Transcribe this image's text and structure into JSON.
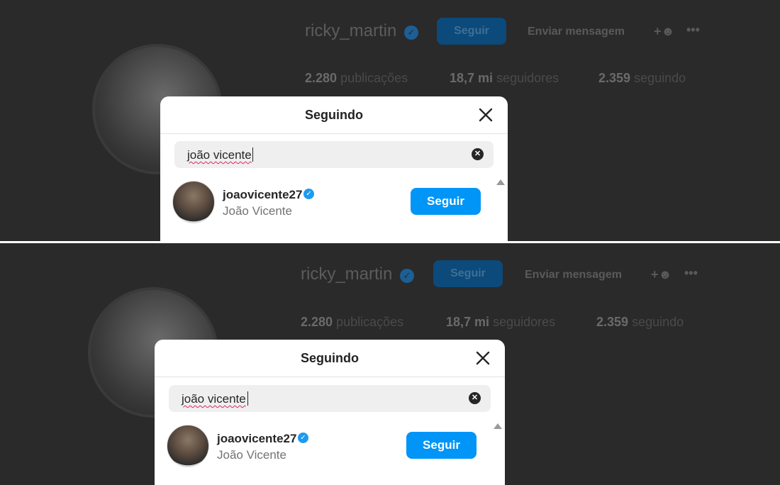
{
  "profile": {
    "username": "ricky_martin",
    "follow_label": "Seguir",
    "message_label": "Enviar mensagem",
    "add_person_icon": "add-person-icon",
    "more_icon": "•••",
    "stats": [
      {
        "value": "2.280",
        "label": "publicações"
      },
      {
        "value": "18,7 mi",
        "label": "seguidores"
      },
      {
        "value": "2.359",
        "label": "seguindo"
      }
    ]
  },
  "modal": {
    "title": "Seguindo",
    "search_value": "joão vicente",
    "result": {
      "username": "joaovicente27",
      "full_name": "João Vicente",
      "follow_label": "Seguir"
    }
  },
  "colors": {
    "accent": "#0095f6",
    "verified": "#1d9bf0",
    "overlay": "#2a2a2a"
  }
}
